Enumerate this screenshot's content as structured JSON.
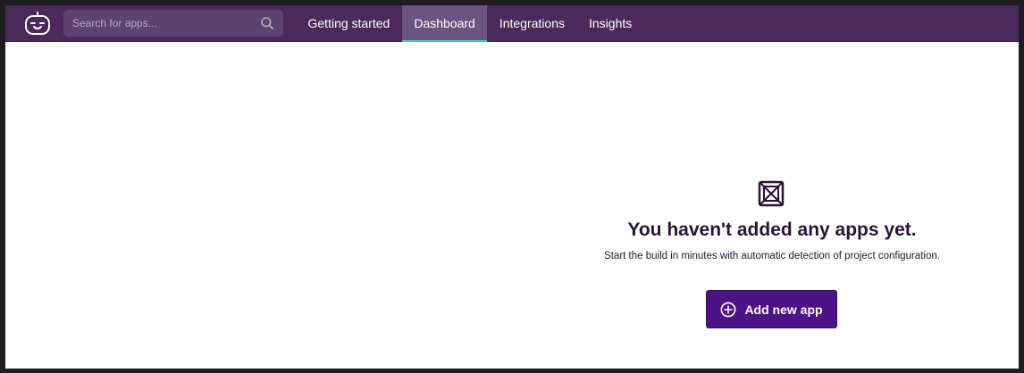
{
  "header": {
    "logo_icon": "robot-face-icon",
    "search": {
      "placeholder": "Search for apps...",
      "value": "",
      "icon": "search-icon"
    },
    "tabs": [
      {
        "label": "Getting started",
        "active": false
      },
      {
        "label": "Dashboard",
        "active": true
      },
      {
        "label": "Integrations",
        "active": false
      },
      {
        "label": "Insights",
        "active": false
      }
    ]
  },
  "empty_state": {
    "icon": "empty-box-icon",
    "title": "You haven't added any apps yet.",
    "subtitle": "Start the build in minutes with automatic detection of project configuration.",
    "button_label": "Add new app",
    "button_icon": "plus-circle-icon"
  },
  "colors": {
    "topbar": "#4b2a5b",
    "active_tab_bg": "#6b5480",
    "active_tab_underline": "#3bd0bf",
    "primary_button": "#4e1287",
    "title_text": "#2b1236"
  }
}
